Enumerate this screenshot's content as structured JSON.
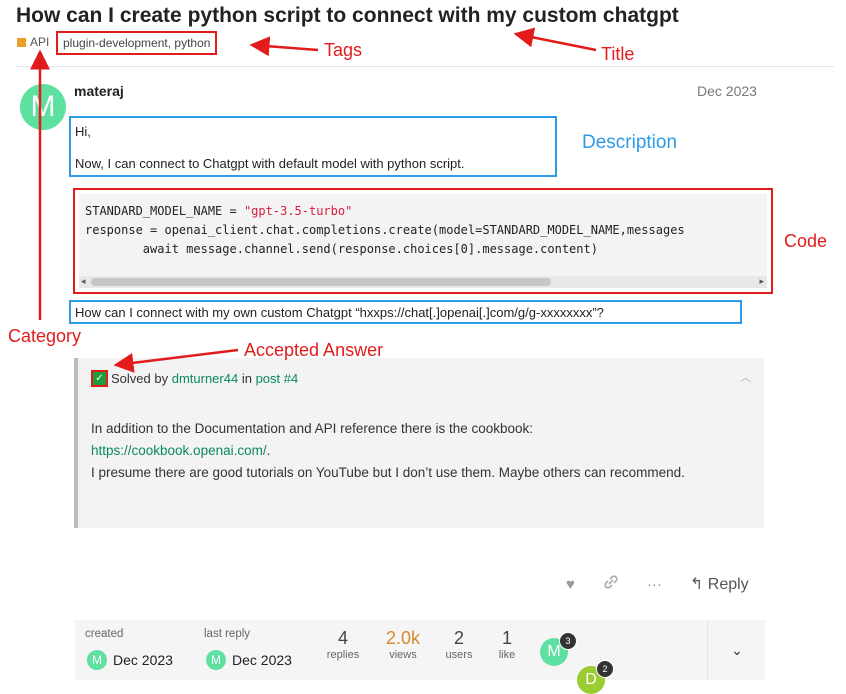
{
  "topic": {
    "title": "How can I create python script to connect with my custom chatgpt",
    "category": "API",
    "tags": "plugin-development, python"
  },
  "post": {
    "avatar_letter": "M",
    "username": "materaj",
    "date": "Dec 2023",
    "description_lines": [
      "Hi,",
      "Now, I can connect to Chatgpt with default model with python script."
    ],
    "code": {
      "line1_pre": "STANDARD_MODEL_NAME = ",
      "line1_str": "\"gpt-3.5-turbo\"",
      "line2": "response = openai_client.chat.completions.create(model=STANDARD_MODEL_NAME,messages",
      "line3": "        await message.channel.send(response.choices[0].message.content)"
    },
    "question": "How can I connect with my own custom Chatgpt “hxxps://chat[.]openai[.]com/g/g-xxxxxxxx”?"
  },
  "solution": {
    "prefix": "Solved by",
    "author": "dmturner44",
    "in_text": "in",
    "post_link": "post #4",
    "body_line1": "In addition to the Documentation and API reference there is the cookbook:",
    "link": "https://cookbook.openai.com/",
    "body_line2": "I presume there are good tutorials on YouTube but I don’t use them. Maybe others can recommend."
  },
  "actions": {
    "reply_label": "Reply",
    "icons": [
      "heart-icon",
      "link-icon",
      "more-icon",
      "reply-icon"
    ]
  },
  "topic_map": {
    "created_label": "created",
    "created_date": "Dec 2023",
    "last_reply_label": "last reply",
    "last_reply_date": "Dec 2023",
    "replies": {
      "value": "4",
      "label": "replies"
    },
    "views": {
      "value": "2.0k",
      "label": "views"
    },
    "users": {
      "value": "2",
      "label": "users"
    },
    "likes": {
      "value": "1",
      "label": "like"
    },
    "participants": [
      {
        "letter": "M",
        "count": "3",
        "color": "#5ee0a0"
      },
      {
        "letter": "D",
        "count": "2",
        "color": "#9acd32"
      }
    ]
  },
  "annotations": {
    "tags": "Tags",
    "title": "Title",
    "description": "Description",
    "code": "Code",
    "category": "Category",
    "accepted_answer": "Accepted Answer"
  },
  "colors": {
    "annotation_red": "#e21b1b",
    "annotation_blue": "#2b9be6",
    "category": "#e8a02b",
    "link_green": "#0a8a5a",
    "views_orange": "#d58a2f"
  }
}
